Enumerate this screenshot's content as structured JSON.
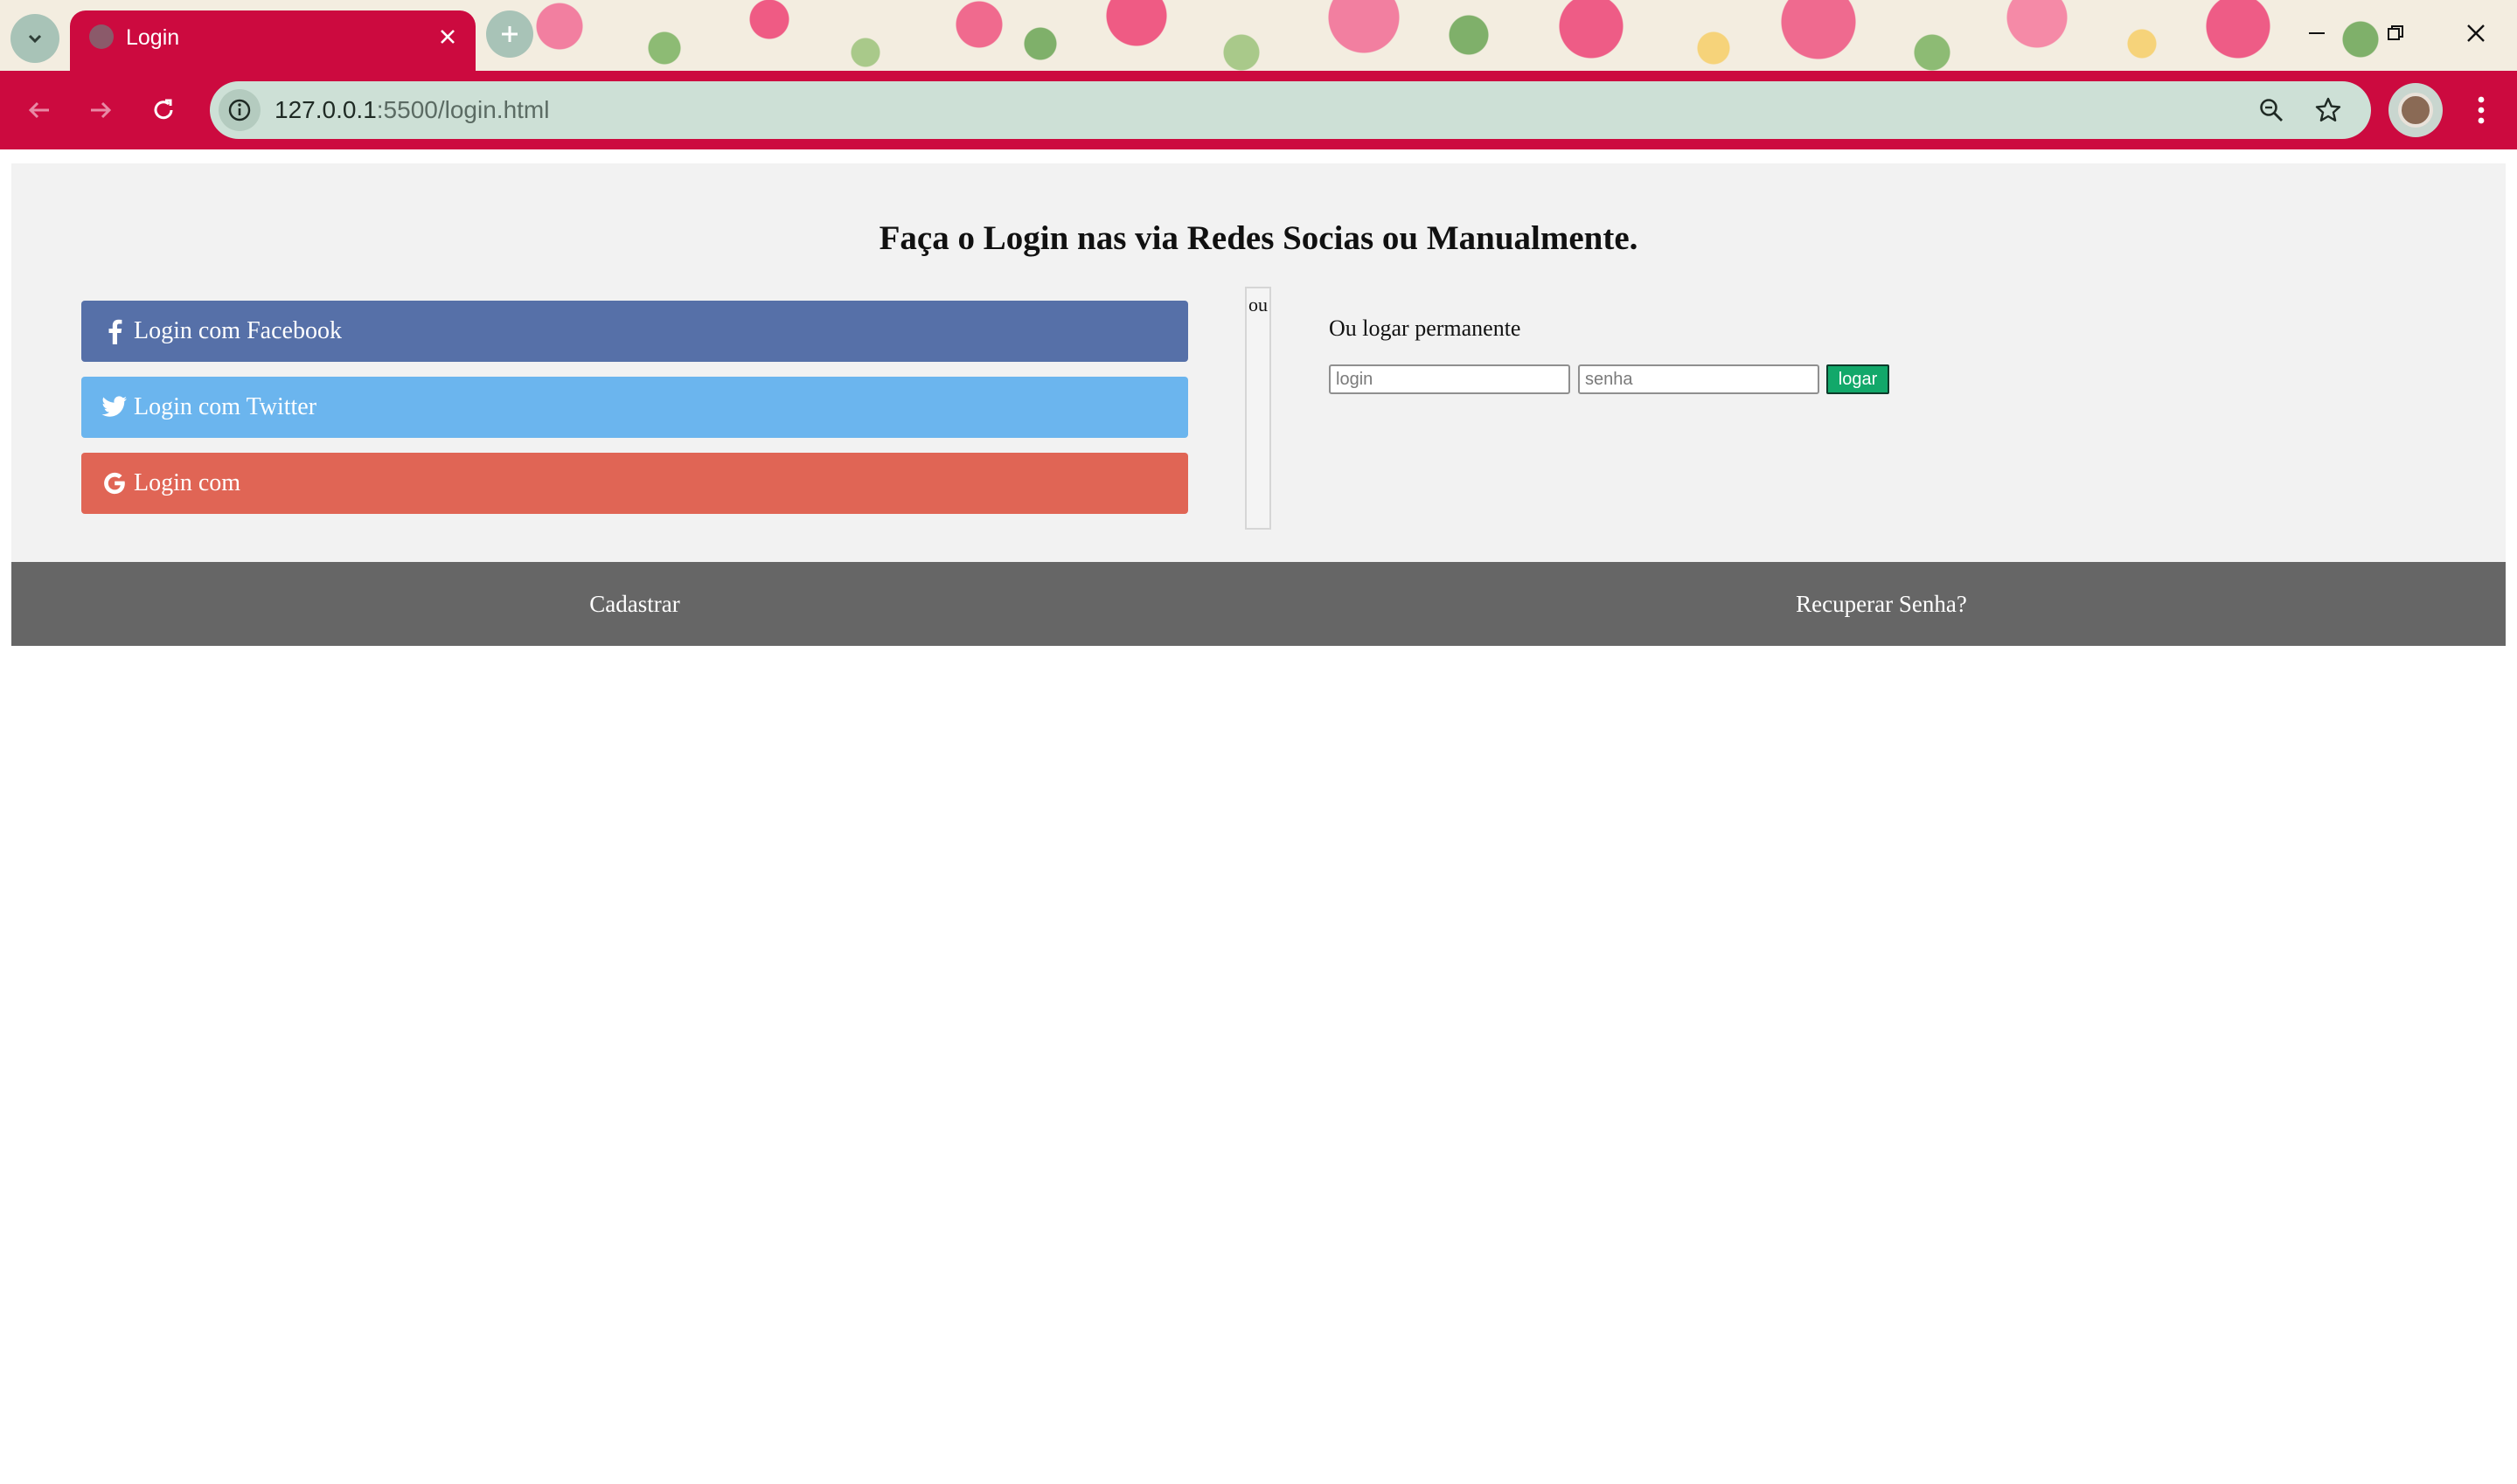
{
  "browser": {
    "tab_title": "Login",
    "url_host": "127.0.0.1",
    "url_path": ":5500/login.html",
    "accent_color": "#cc0a3f"
  },
  "page": {
    "heading": "Faça o Login nas via Redes Socias ou Manualmente.",
    "social_buttons": [
      {
        "label": "Login com Facebook",
        "icon": "facebook-icon",
        "color": "#5670a8"
      },
      {
        "label": "Login com Twitter",
        "icon": "twitter-icon",
        "color": "#6bb5ee"
      },
      {
        "label": "Login com",
        "icon": "google-icon",
        "color": "#e06555"
      }
    ],
    "divider_label": "ou",
    "manual": {
      "label": "Ou logar permanente",
      "login_placeholder": "login",
      "senha_placeholder": "senha",
      "submit_label": "logar",
      "submit_color": "#12a86a"
    },
    "footer": {
      "cadastrar": "Cadastrar",
      "recuperar": "Recuperar Senha?"
    }
  }
}
